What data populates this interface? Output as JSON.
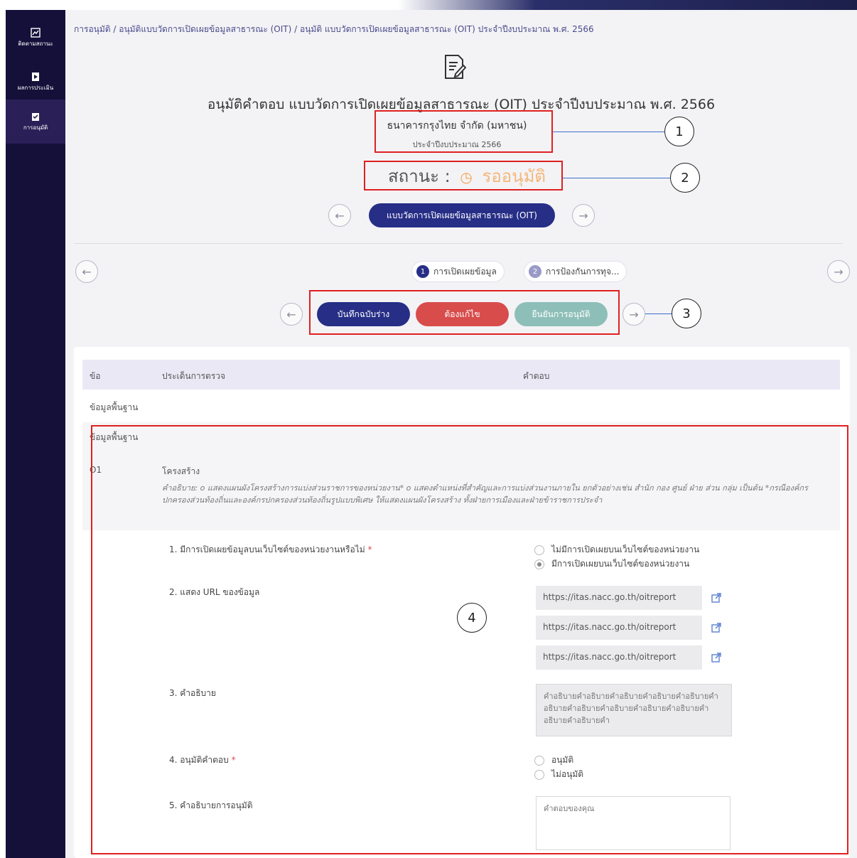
{
  "sidebar": {
    "items": [
      {
        "label": "ติดตามสถานะ",
        "icon": "chart-icon"
      },
      {
        "label": "ผลการประเมิน",
        "icon": "document-icon"
      },
      {
        "label": "การอนุมัติ",
        "icon": "clipboard-check-icon"
      }
    ]
  },
  "breadcrumb": "การอนุมัติ / อนุมัติแบบวัดการเปิดเผยข้อมูลสาธารณะ (OIT) / อนุมัติ แบบวัดการเปิดเผยข้อมูลสาธารณะ (OIT) ประจำปีงบประมาณ พ.ศ. 2566",
  "page_title": "อนุมัติคำตอบ แบบวัดการเปิดเผยข้อมูลสาธารณะ (OIT) ประจำปีงบประมาณ พ.ศ. 2566",
  "org_name": "ธนาคารกรุงไทย จำกัด (มหาชน)",
  "fiscal_year": "ประจำปีงบประมาณ 2566",
  "status": {
    "label": "สถานะ :",
    "value": "รออนุมัติ",
    "color": "#f5b77a"
  },
  "form_nav": {
    "current": "แบบวัดการเปิดเผยข้อมูลสาธารณะ (OIT)"
  },
  "steps": [
    {
      "num": "1",
      "label": "การเปิดเผยข้อมูล"
    },
    {
      "num": "2",
      "label": "การป้องกันการทุจ..."
    }
  ],
  "actions": {
    "save_draft": "บันทึกฉบับร่าง",
    "needs_fix": "ต้องแก้ไข",
    "confirm": "ยืนยันการอนุมัติ"
  },
  "table": {
    "headers": [
      "ข้อ",
      "ประเด็นการตรวจ",
      "คำตอบ"
    ],
    "group_1": "ข้อมูลพื้นฐาน",
    "group_2": "ข้อมูลพื้นฐาน",
    "item_code": "O1",
    "item_title": "โครงสร้าง",
    "item_desc": "คำอธิบาย: o แสดงแผนผังโครงสร้างการแบ่งส่วนราชการของหน่วยงาน* o แสดงตำแหน่งที่สำคัญและการแบ่งส่วนงานภายใน ยกตัวอย่างเช่น สำนัก กอง ศูนย์ ฝ่าย ส่วน กลุ่ม เป็นต้น *กรณีองค์กรปกครองส่วนท้องถิ่นและองค์กรปกครองส่วนท้องถิ่นรูปแบบพิเศษ ให้แสดงแผนผังโครงสร้าง ทั้งฝ่ายการเมืองและฝ่ายข้าราชการประจำ"
  },
  "questions": {
    "q1": "1. มีการเปิดเผยข้อมูลบนเว็บไซต์ของหน่วยงานหรือไม่",
    "q1_opt_no": "ไม่มีการเปิดเผยบนเว็บไซต์ของหน่วยงาน",
    "q1_opt_yes": "มีการเปิดเผยบนเว็บไซต์ของหน่วยงาน",
    "q2": "2. แสดง URL ของข้อมูล",
    "urls": [
      "https://itas.nacc.go.th/oitreport",
      "https://itas.nacc.go.th/oitreport",
      "https://itas.nacc.go.th/oitreport"
    ],
    "q3": "3. คำอธิบาย",
    "q3_text": "คำอธิบายคำอธิบายคำอธิบายคำอธิบายคำอธิบายคำอธิบายคำอธิบายคำอธิบายคำอธิบายคำอธิบายคำอธิบายคำอธิบายคำ",
    "q4": "4. อนุมัติคำตอบ",
    "q4_approve": "อนุมัติ",
    "q4_reject": "ไม่อนุมัติ",
    "q5": "5. คำอธิบายการอนุมัติ",
    "q5_placeholder": "คำตอบของคุณ"
  },
  "annotations": [
    "1",
    "2",
    "3",
    "4"
  ]
}
